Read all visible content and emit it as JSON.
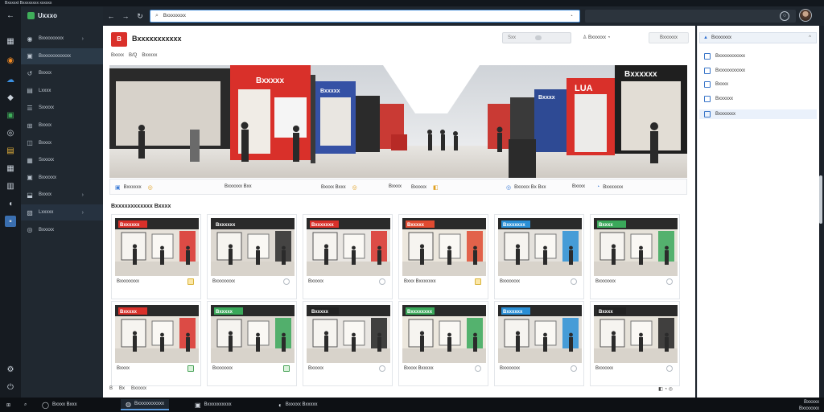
{
  "window": {
    "title": "Bxxxxxt Bxxxxxxxx xxxxxx"
  },
  "rail": {
    "icons": [
      "back-arrow-icon",
      "grid-icon",
      "orange-circle-icon",
      "cloud-icon",
      "shield-icon",
      "green-doc-icon",
      "ring-icon",
      "briefcase-icon",
      "gallery-icon",
      "bar-icon",
      "panel-icon",
      "folder-icon",
      "chat-icon",
      "settings-icon",
      "power-icon"
    ]
  },
  "nav": {
    "brand": "Uxxxo",
    "items": [
      {
        "label": "Bxxxxxxxxx",
        "icon": "◉",
        "chevron": true
      },
      {
        "label": "Bxxxxxxxxxxxx",
        "icon": "▣",
        "chevron": false,
        "active": true
      },
      {
        "label": "Bxxxx",
        "icon": "↺",
        "chevron": false
      },
      {
        "label": "Lxxxx",
        "icon": "▤",
        "chevron": false
      },
      {
        "label": "Sxxxxx",
        "icon": "☰",
        "chevron": false
      },
      {
        "label": "Bxxxx",
        "icon": "⊞",
        "chevron": false
      },
      {
        "label": "Bxxxx",
        "icon": "◫",
        "chevron": false
      },
      {
        "label": "Sxxxxx",
        "icon": "▦",
        "chevron": false
      },
      {
        "label": "Bxxxxxx",
        "icon": "▣",
        "chevron": false
      },
      {
        "label": "Bxxxx",
        "icon": "⬓",
        "chevron": true
      },
      {
        "label": "Lxxxxx",
        "icon": "▧",
        "chevron": true,
        "highlight": true
      },
      {
        "label": "Bxxxxx",
        "icon": "◎",
        "chevron": false
      }
    ]
  },
  "browser": {
    "address": "Bxxxxxxxx",
    "back": "←",
    "forward": "→",
    "reload": "↻"
  },
  "page": {
    "logo_text": "B",
    "title": "Bxxxxxxxxxxx",
    "search_label": "Sxx",
    "user_label": "Bxxxxxx",
    "menu_label": "Bxxxxxx",
    "breadcrumb": [
      "Bxxxx",
      "B/Q",
      "Bxxxxx"
    ],
    "hero_signs": [
      "Bxxxxx",
      "Bxxxxx",
      "Bxxxx",
      "Bxxxxxx",
      "LUA"
    ],
    "info_items": [
      {
        "label": "Bxxxxxx",
        "icon": "▣",
        "end": "◎"
      },
      {
        "label": "Bxxxxxx Bxx",
        "icon": "",
        "end": ""
      },
      {
        "label": "Bxxxx Bxxx",
        "icon": "",
        "end": "◎"
      },
      {
        "label": "Bxxxx",
        "icon": "",
        "end": ""
      },
      {
        "label": "Bxxxxx",
        "icon": "",
        "end": "◧"
      },
      {
        "label": "Bxxxxx Bx Bxx",
        "icon": "◎",
        "end": ""
      },
      {
        "label": "Bxxxx",
        "icon": "",
        "end": ""
      },
      {
        "label": "Bxxxxxxx",
        "icon": "◔",
        "end": ""
      }
    ],
    "section_title": "Bxxxxxxxxxxxx Bxxxx",
    "cards": [
      {
        "caption": "Bxxxxxxxx",
        "sign": "Bxxxxxx",
        "sign_color": "#d9302a",
        "icon": "tag"
      },
      {
        "caption": "Bxxxxxxxx",
        "sign": "Bxxxxxx",
        "sign_color": "#2a2a2a",
        "icon": "circle"
      },
      {
        "caption": "Bxxxxx",
        "sign": "Bxxxxxxx",
        "sign_color": "#d9302a",
        "icon": "circle"
      },
      {
        "caption": "Bxxx Bxxxxxxx",
        "sign": "Bxxxxx",
        "sign_color": "#e04a30",
        "icon": "tag"
      },
      {
        "caption": "Bxxxxxxx",
        "sign": "Bxxxxxxx",
        "sign_color": "#2a8fd6",
        "icon": "circle"
      },
      {
        "caption": "Bxxxxxxx",
        "sign": "Bxxxx",
        "sign_color": "#3aa85a",
        "icon": "circle"
      },
      {
        "caption": "Bxxxx",
        "sign": "Bxxxxx",
        "sign_color": "#d9302a",
        "icon": "tag-green"
      },
      {
        "caption": "Bxxxxxxx",
        "sign": "Bxxxxx",
        "sign_color": "#3aa85a",
        "icon": "tag-green"
      },
      {
        "caption": "Bxxxxx",
        "sign": "Bxxxxx",
        "sign_color": "#222222",
        "icon": "circle"
      },
      {
        "caption": "Bxxxx Bxxxxx",
        "sign": "Bxxxxxxxx",
        "sign_color": "#3aa85a",
        "icon": "circle"
      },
      {
        "caption": "Bxxxxxxx",
        "sign": "Bxxxxxx",
        "sign_color": "#2a8fd6",
        "icon": "circle"
      },
      {
        "caption": "Bxxxxxx",
        "sign": "Bxxxx",
        "sign_color": "#222222",
        "icon": "circle"
      }
    ],
    "footer_left": [
      "B",
      "Bx",
      "Bxxxxx"
    ],
    "footer_right": "◧ ◔ ◎"
  },
  "right_panel": {
    "header": "Bxxxxxxx",
    "items": [
      {
        "label": "Bxxxxxxxxxxx",
        "selected": false
      },
      {
        "label": "Bxxxxxxxxxxx",
        "selected": false
      },
      {
        "label": "Bxxxx",
        "selected": false
      },
      {
        "label": "Bxxxxxx",
        "selected": false
      },
      {
        "label": "Bxxxxxxx",
        "selected": true
      }
    ]
  },
  "taskbar": {
    "items": [
      {
        "label": "Bxxxx Bxxx",
        "icon": "◯"
      },
      {
        "label": "Bxxxxxxxxxxx",
        "icon": "◍",
        "active": true
      },
      {
        "label": "Bxxxxxxxxxx",
        "icon": "▣"
      },
      {
        "label": "Bxxxxx Bxxxxx",
        "icon": "◐"
      }
    ],
    "tray_line1": "Bxxxxx",
    "tray_line2": "Bxxxxxxx"
  },
  "colors": {
    "accent": "#4a90d9",
    "brand_red": "#d9302a",
    "sidebar": "#202830"
  }
}
